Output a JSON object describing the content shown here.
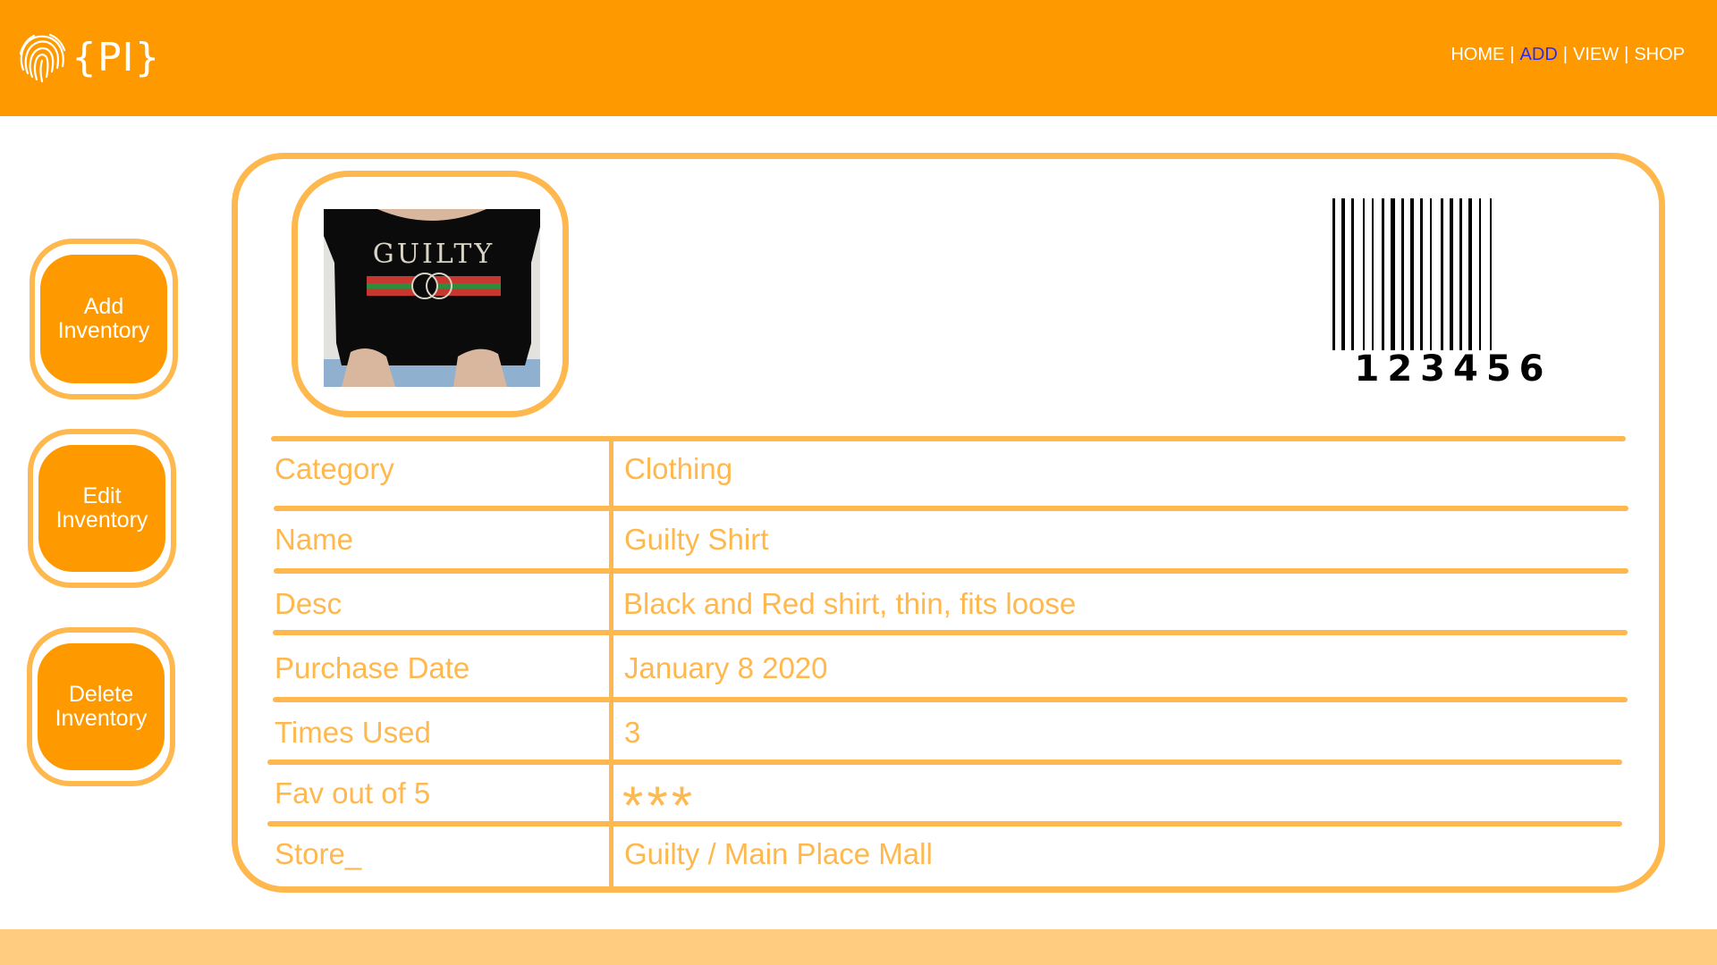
{
  "header": {
    "logo_text": "{PI}",
    "nav": {
      "home": "HOME",
      "add": "ADD",
      "view": "VIEW",
      "shop": "SHOP",
      "separator": "|"
    },
    "nav_active": "ADD"
  },
  "sidebar": {
    "add_label": "Add\nInventory",
    "edit_label": "Edit\nInventory",
    "delete_label": "Delete\nInventory"
  },
  "item": {
    "barcode_number": "123456",
    "shirt_print": "GUILTY",
    "rows": [
      {
        "label": "Category",
        "value": "Clothing"
      },
      {
        "label": "Name",
        "value": "Guilty Shirt"
      },
      {
        "label": "Desc",
        "value": "Black and Red shirt, thin, fits loose"
      },
      {
        "label": "Purchase Date",
        "value": "January 8 2020"
      },
      {
        "label": "Times Used",
        "value": "3"
      },
      {
        "label": "Fav out of 5",
        "value": "***"
      },
      {
        "label": "Store_",
        "value": "Guilty / Main Place Mall"
      }
    ]
  },
  "colors": {
    "primary": "#ff9900",
    "accent": "#ffb84d",
    "footer": "#ffcc80",
    "nav_active": "#2a2aff"
  },
  "icons": {
    "logo": "fingerprint-icon"
  }
}
